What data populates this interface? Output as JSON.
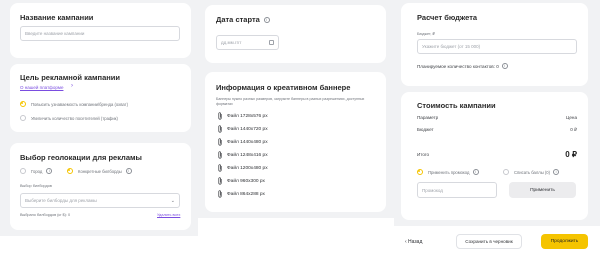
{
  "campaign_name": {
    "title": "Название кампании",
    "placeholder": "Введите название кампании"
  },
  "goal": {
    "title": "Цель рекламной кампании",
    "link": "О нашей платформе",
    "options": [
      "Повысить узнаваемость компании/бренда (охват)",
      "Увеличить количество посетителей (трафик)"
    ]
  },
  "geo": {
    "title": "Выбор геолокации для рекламы",
    "options": [
      "Город",
      "Конкретные билборды"
    ],
    "billboard_label": "Выбор билбордов",
    "billboard_placeholder": "Выберите билборды для рекламы",
    "selected_count": "Выбрано билбордов (кг $): 0",
    "clear_all": "Удалить всех"
  },
  "start_date": {
    "title": "Дата старта",
    "placeholder": "дд.мм.гггг"
  },
  "creative": {
    "title": "Информация о креативном баннере",
    "description": "Баннеры нужно разных размеров, загрузите баннеры в разных разрешениях, доступных форматах",
    "files": [
      "Файл 1728x576 px",
      "Файл 1440x720 px",
      "Файл 1440x480 px",
      "Файл 1248x416 px",
      "Файл 1200x480 px",
      "Файл 960x300 px",
      "Файл 864x288 px"
    ]
  },
  "budget": {
    "title": "Расчет бюджета",
    "label": "Бюджет, ₽",
    "placeholder": "Укажите бюджет (от 15 000)",
    "contacts": "Планируемое количество контактов: 0"
  },
  "cost": {
    "title": "Стоимость кампании",
    "col_param": "Параметр",
    "col_price": "Цена",
    "budget_label": "Бюджет",
    "budget_value": "0 ₽",
    "total_label": "Итого",
    "total_value": "0 ₽",
    "promo_option": "Применить промокод",
    "bonus_option": "Списать баллы (0)",
    "promo_placeholder": "Промокод",
    "apply_button": "Применить"
  },
  "footer": {
    "back": "‹ Назад",
    "save_draft": "Сохранить в черновик",
    "continue": "Продолжить"
  },
  "colors": {
    "accent": "#f5c400",
    "link": "#7a4de0",
    "background": "#f1f2f4",
    "card": "#ffffff"
  }
}
